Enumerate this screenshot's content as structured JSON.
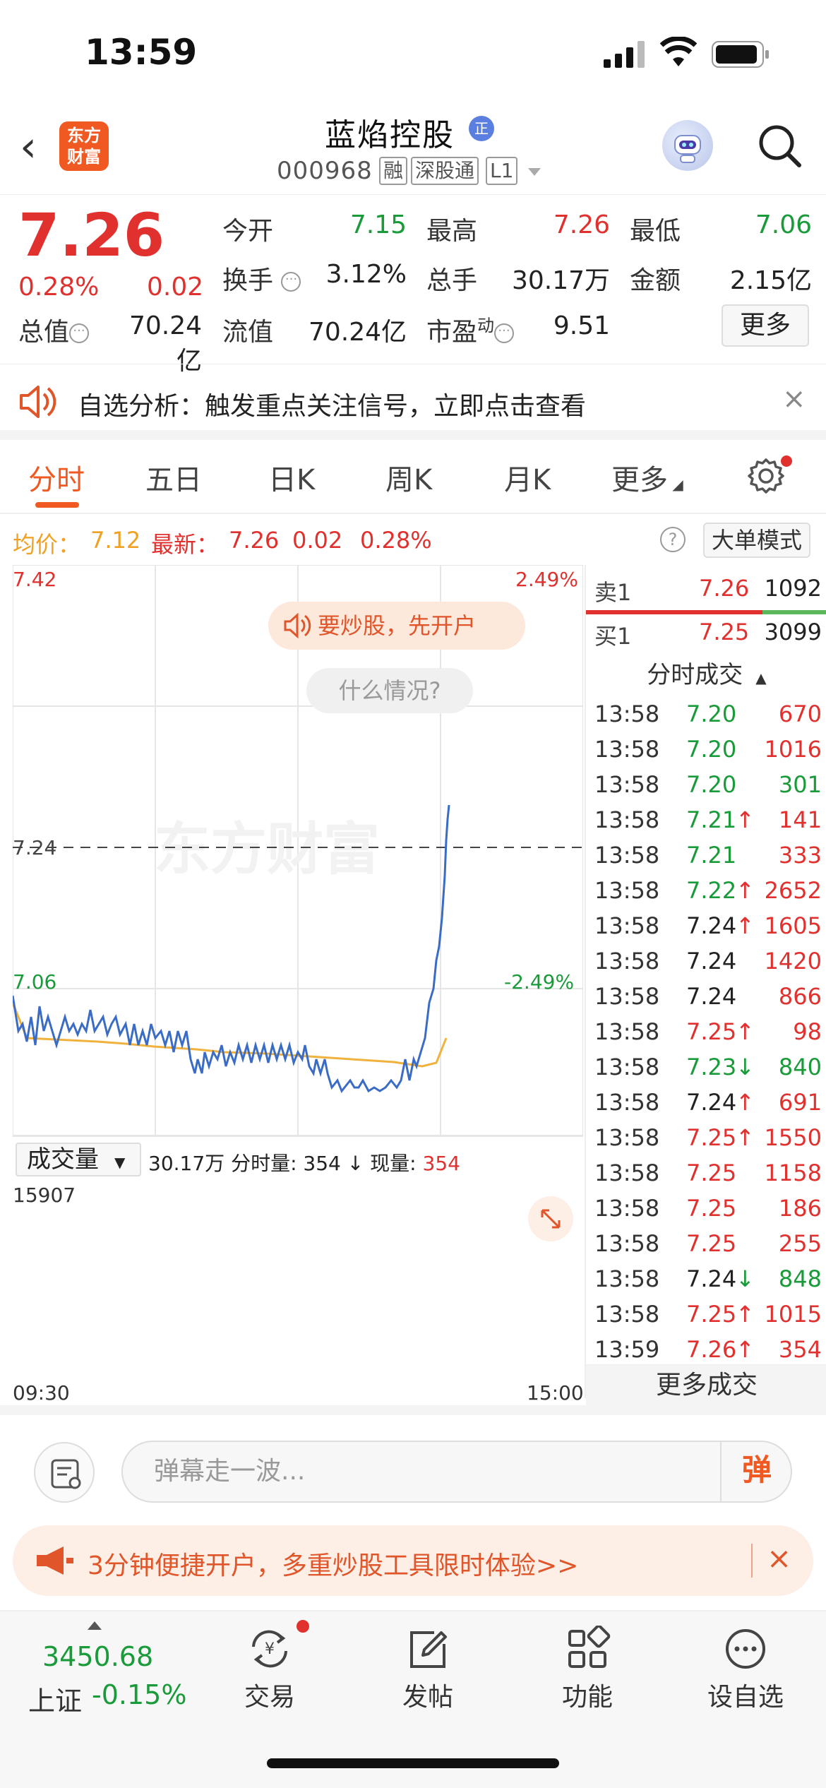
{
  "status": {
    "time": "13:59"
  },
  "header": {
    "back_icon": "chevron-left-icon",
    "logo_text": [
      "东方",
      "财富"
    ],
    "name": "蓝焰控股",
    "name_badge": "正",
    "code": "000968",
    "tags": [
      "融",
      "深股通",
      "L1"
    ]
  },
  "quote": {
    "price": "7.26",
    "pct": "0.28%",
    "change": "0.02",
    "open_label": "今开",
    "open": "7.15",
    "high_label": "最高",
    "high": "7.26",
    "low_label": "最低",
    "low": "7.06",
    "turnover_label": "换手",
    "turnover": "3.12%",
    "volume_label": "总手",
    "volume": "30.17万",
    "amount_label": "金额",
    "amount": "2.15亿",
    "mktcap_label": "总值",
    "mktcap": "70.24亿",
    "float_label": "流值",
    "float": "70.24亿",
    "pe_label": "市盈",
    "pe_sup": "动",
    "pe": "9.51",
    "more_label": "更多",
    "colors": {
      "up": "#e0312f",
      "down": "#1a9b3a"
    }
  },
  "notice": {
    "text": "自选分析：触发重点关注信号，立即点击查看",
    "close": "×"
  },
  "tabs": [
    "分时",
    "五日",
    "日K",
    "周K",
    "月K",
    "更多"
  ],
  "infoline": {
    "avg_label": "均价：",
    "avg": "7.12",
    "latest_label": "最新：",
    "latest": "7.26",
    "latest_chg": "0.02",
    "latest_pct": "0.28%",
    "help": "?",
    "bigorder": "大单模式"
  },
  "chart": {
    "price_max": "7.42",
    "price_min": "7.06",
    "pct_max": "2.49%",
    "pct_min": "-2.49%",
    "ref_price": "7.24",
    "pill1": "要炒股，先开户",
    "pill2": "什么情况?",
    "vol_select": "成交量",
    "vol_total": "30.17万",
    "vol_time_label": "分时量:",
    "vol_time": "354",
    "vol_now_label": "现量:",
    "vol_now": "354",
    "vol_max": "15907",
    "time_start": "09:30",
    "time_end": "15:00",
    "watermark": "东方财富"
  },
  "book": {
    "sell": {
      "label": "卖1",
      "price": "7.26",
      "qty": "1092"
    },
    "buy": {
      "label": "买1",
      "price": "7.25",
      "qty": "3099"
    },
    "ticks_title": "分时成交",
    "ticks": [
      {
        "t": "13:58",
        "p": "7.20",
        "q": "670",
        "pc": "green",
        "qc": "red",
        "arrow": ""
      },
      {
        "t": "13:58",
        "p": "7.20",
        "q": "1016",
        "pc": "green",
        "qc": "red",
        "arrow": ""
      },
      {
        "t": "13:58",
        "p": "7.20",
        "q": "301",
        "pc": "green",
        "qc": "green",
        "arrow": ""
      },
      {
        "t": "13:58",
        "p": "7.21",
        "q": "141",
        "pc": "green",
        "qc": "red",
        "arrow": "↑"
      },
      {
        "t": "13:58",
        "p": "7.21",
        "q": "333",
        "pc": "green",
        "qc": "red",
        "arrow": ""
      },
      {
        "t": "13:58",
        "p": "7.22",
        "q": "2652",
        "pc": "green",
        "qc": "red",
        "arrow": "↑"
      },
      {
        "t": "13:58",
        "p": "7.24",
        "q": "1605",
        "pc": "black",
        "qc": "red",
        "arrow": "↑"
      },
      {
        "t": "13:58",
        "p": "7.24",
        "q": "1420",
        "pc": "black",
        "qc": "red",
        "arrow": ""
      },
      {
        "t": "13:58",
        "p": "7.24",
        "q": "866",
        "pc": "black",
        "qc": "red",
        "arrow": ""
      },
      {
        "t": "13:58",
        "p": "7.25",
        "q": "98",
        "pc": "red",
        "qc": "red",
        "arrow": "↑"
      },
      {
        "t": "13:58",
        "p": "7.23",
        "q": "840",
        "pc": "green",
        "qc": "green",
        "arrow": "↓"
      },
      {
        "t": "13:58",
        "p": "7.24",
        "q": "691",
        "pc": "black",
        "qc": "red",
        "arrow": "↑"
      },
      {
        "t": "13:58",
        "p": "7.25",
        "q": "1550",
        "pc": "red",
        "qc": "red",
        "arrow": "↑"
      },
      {
        "t": "13:58",
        "p": "7.25",
        "q": "1158",
        "pc": "red",
        "qc": "red",
        "arrow": ""
      },
      {
        "t": "13:58",
        "p": "7.25",
        "q": "186",
        "pc": "red",
        "qc": "red",
        "arrow": ""
      },
      {
        "t": "13:58",
        "p": "7.25",
        "q": "255",
        "pc": "red",
        "qc": "red",
        "arrow": ""
      },
      {
        "t": "13:58",
        "p": "7.24",
        "q": "848",
        "pc": "black",
        "qc": "green",
        "arrow": "↓"
      },
      {
        "t": "13:58",
        "p": "7.25",
        "q": "1015",
        "pc": "red",
        "qc": "red",
        "arrow": "↑"
      },
      {
        "t": "13:59",
        "p": "7.26",
        "q": "354",
        "pc": "red",
        "qc": "red",
        "arrow": "↑"
      }
    ],
    "more_trades": "更多成交"
  },
  "danmaku": {
    "placeholder": "弹幕走一波...",
    "send": "弹"
  },
  "promo": {
    "text": "3分钟便捷开户，多重炒股工具限时体验>>",
    "close": "×"
  },
  "bottomnav": {
    "index_value": "3450.68",
    "index_name": "上证",
    "index_change": "-0.15%",
    "items": [
      {
        "label": "交易",
        "icon": "yuan-exchange-icon"
      },
      {
        "label": "发帖",
        "icon": "edit-icon"
      },
      {
        "label": "功能",
        "icon": "grid-icon"
      },
      {
        "label": "设自选",
        "icon": "more-dots-icon"
      }
    ]
  }
}
